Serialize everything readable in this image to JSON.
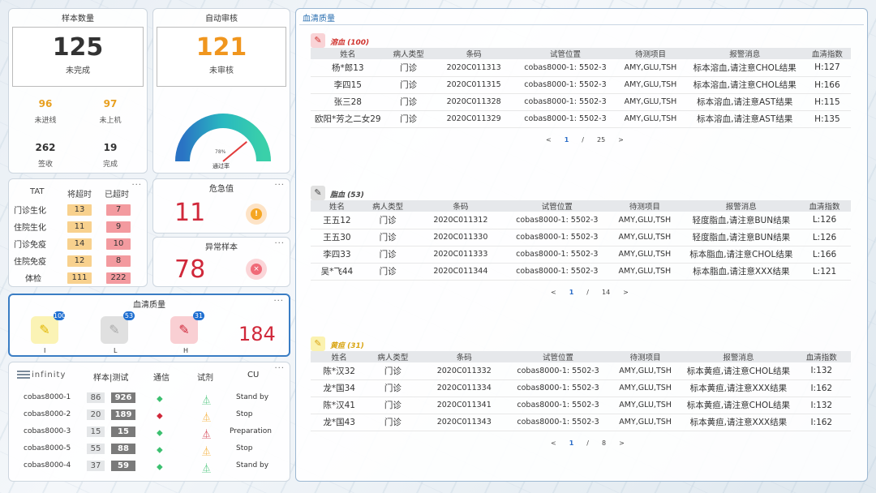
{
  "sample_count": {
    "title": "样本数量",
    "value": "125",
    "sub": "未完成",
    "stats": [
      {
        "n": "96",
        "l": "未进线",
        "c": "#e8a020"
      },
      {
        "n": "97",
        "l": "未上机",
        "c": "#e8a020"
      },
      {
        "n": "262",
        "l": "签收",
        "c": "#333"
      },
      {
        "n": "19",
        "l": "完成",
        "c": "#333"
      }
    ]
  },
  "auto_review": {
    "title": "自动审核",
    "value": "121",
    "sub": "未审核",
    "gauge_pct": "78%",
    "gauge_label": "通过率",
    "gauge_value": 0.78
  },
  "tat": {
    "headers": [
      "TAT",
      "将超时",
      "已超时"
    ],
    "rows": [
      {
        "name": "门诊生化",
        "a": "13",
        "b": "7"
      },
      {
        "name": "住院生化",
        "a": "11",
        "b": "9"
      },
      {
        "name": "门诊免疫",
        "a": "14",
        "b": "10"
      },
      {
        "name": "住院免疫",
        "a": "12",
        "b": "8"
      },
      {
        "name": "体检",
        "a": "111",
        "b": "222"
      }
    ]
  },
  "critical": {
    "title": "危急值",
    "value": "11"
  },
  "abnormal": {
    "title": "异常样本",
    "value": "78"
  },
  "serum": {
    "title": "血清质量",
    "items": [
      {
        "label": "I",
        "badge": "100"
      },
      {
        "label": "L",
        "badge": "53"
      },
      {
        "label": "H",
        "badge": "31"
      }
    ],
    "value": "184"
  },
  "instruments": {
    "brand": "infinity",
    "headers": [
      "样本|测试",
      "通信",
      "试剂",
      "CU"
    ],
    "rows": [
      {
        "name": "cobas8000-1",
        "a": "86",
        "b": "926",
        "status": "Stand by"
      },
      {
        "name": "cobas8000-2",
        "a": "20",
        "b": "189",
        "status": "Stop"
      },
      {
        "name": "cobas8000-3",
        "a": "15",
        "b": "15",
        "status": "Preparation"
      },
      {
        "name": "cobas8000-5",
        "a": "55",
        "b": "88",
        "status": "Stop"
      },
      {
        "name": "cobas8000-4",
        "a": "37",
        "b": "59",
        "status": "Stand by"
      }
    ]
  },
  "quality": {
    "title": "血清质量",
    "sections": [
      {
        "name": "溶血",
        "count": "(100)",
        "color": "#d0332e",
        "headers": [
          "姓名",
          "病人类型",
          "条码",
          "试管位置",
          "待测项目",
          "报警消息",
          "血清指数"
        ],
        "rows": [
          [
            "杨*郎13",
            "门诊",
            "2020C011313",
            "cobas8000-1: 5502-3",
            "AMY,GLU,TSH",
            "标本溶血,请注意CHOL结果",
            "H:127"
          ],
          [
            "李四15",
            "门诊",
            "2020C011315",
            "cobas8000-1: 5502-3",
            "AMY,GLU,TSH",
            "标本溶血,请注意CHOL结果",
            "H:166"
          ],
          [
            "张三28",
            "门诊",
            "2020C011328",
            "cobas8000-1: 5502-3",
            "AMY,GLU,TSH",
            "标本溶血,请注意AST结果",
            "H:115"
          ],
          [
            "欧阳*芳之二女29",
            "门诊",
            "2020C011329",
            "cobas8000-1: 5502-3",
            "AMY,GLU,TSH",
            "标本溶血,请注意AST结果",
            "H:135"
          ]
        ],
        "pager": [
          "<",
          "1",
          "/",
          "25",
          ">"
        ]
      },
      {
        "name": "脂血",
        "count": "(53)",
        "color": "#444",
        "headers": [
          "姓名",
          "病人类型",
          "条码",
          "试管位置",
          "待测项目",
          "报警消息",
          "血清指数"
        ],
        "rows": [
          [
            "王五12",
            "门诊",
            "2020C011312",
            "cobas8000-1: 5502-3",
            "AMY,GLU,TSH",
            "轻度脂血,请注意BUN结果",
            "L:126"
          ],
          [
            "王五30",
            "门诊",
            "2020C011330",
            "cobas8000-1: 5502-3",
            "AMY,GLU,TSH",
            "轻度脂血,请注意BUN结果",
            "L:126"
          ],
          [
            "李四33",
            "门诊",
            "2020C011333",
            "cobas8000-1: 5502-3",
            "AMY,GLU,TSH",
            "标本脂血,请注意CHOL结果",
            "L:166"
          ],
          [
            "吴*飞44",
            "门诊",
            "2020C011344",
            "cobas8000-1: 5502-3",
            "AMY,GLU,TSH",
            "标本脂血,请注意XXX结果",
            "L:121"
          ]
        ],
        "pager": [
          "<",
          "1",
          "/",
          "14",
          ">"
        ]
      },
      {
        "name": "黄疸",
        "count": "(31)",
        "color": "#d9a514",
        "headers": [
          "姓名",
          "病人类型",
          "条码",
          "试管位置",
          "待测项目",
          "报警消息",
          "血清指数"
        ],
        "rows": [
          [
            "陈*汉32",
            "门诊",
            "2020C011332",
            "cobas8000-1: 5502-3",
            "AMY,GLU,TSH",
            "标本黄疸,请注意CHOL结果",
            "I:132"
          ],
          [
            "龙*国34",
            "门诊",
            "2020C011334",
            "cobas8000-1: 5502-3",
            "AMY,GLU,TSH",
            "标本黄疸,请注意XXX结果",
            "I:162"
          ],
          [
            "陈*汉41",
            "门诊",
            "2020C011341",
            "cobas8000-1: 5502-3",
            "AMY,GLU,TSH",
            "标本黄疸,请注意CHOL结果",
            "I:132"
          ],
          [
            "龙*国43",
            "门诊",
            "2020C011343",
            "cobas8000-1: 5502-3",
            "AMY,GLU,TSH",
            "标本黄疸,请注意XXX结果",
            "I:162"
          ]
        ],
        "pager": [
          "<",
          "1",
          "/",
          "8",
          ">"
        ]
      }
    ]
  }
}
